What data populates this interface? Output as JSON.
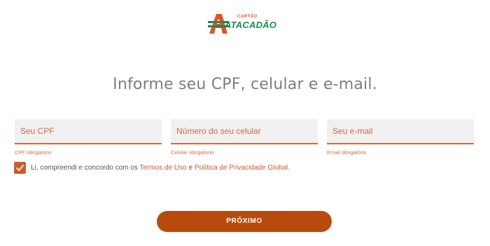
{
  "logo": {
    "top_text": "CARTÃO",
    "main_text": "ATACADÃO",
    "colors": {
      "orange": "#e0542a",
      "green": "#1e8a52"
    }
  },
  "title": "Informe seu CPF, celular e e-mail.",
  "fields": {
    "cpf": {
      "placeholder": "Seu CPF",
      "error": "CPF obrigatório"
    },
    "phone": {
      "placeholder": "Número do seu celular",
      "error": "Celular obrigatório"
    },
    "email": {
      "placeholder": "Seu e-mail",
      "error": "Email obrigatório"
    }
  },
  "consent": {
    "checked": true,
    "text_before": "Li, compreendi e concordo com os ",
    "terms_link": "Termos de Uso",
    "text_middle": " e ",
    "privacy_link": "Política de Privacidade Global",
    "text_after": "."
  },
  "button": {
    "label": "PRÓXIMO"
  },
  "colors": {
    "accent": "#cd5a2b",
    "button": "#b94a0e",
    "field_bg": "#f1f0f1",
    "title": "#7d7d7d"
  },
  "icons": {
    "checkbox": "checkmark-icon",
    "logo": "atacadao-a-logo-icon"
  }
}
